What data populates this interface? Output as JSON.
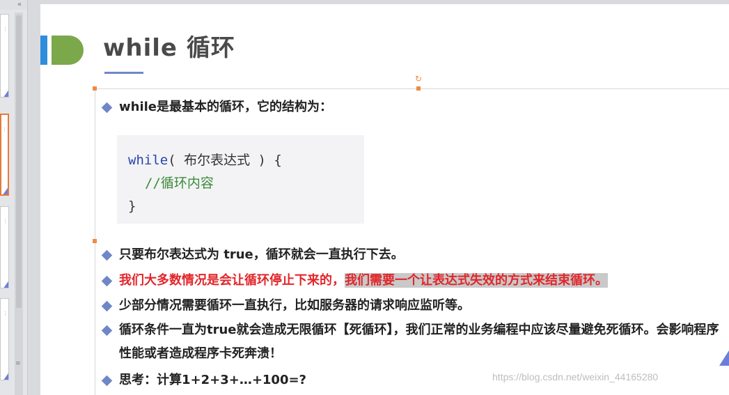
{
  "thumbnails": {
    "collapse_arrow": "«",
    "dots": "⋮",
    "grip": "≡"
  },
  "slide": {
    "title": "while 循环",
    "rotate_glyph": "↻",
    "bullets": {
      "b1": "while是最基本的循环，它的结构为：",
      "b2": "只要布尔表达式为 true，循环就会一直执行下去。",
      "b3_part1": "我们大多数情况是会让循环停止下来的，",
      "b3_part2": "我们需要一个让表达式失效的方式来结束循环。",
      "b4": "少部分情况需要循环一直执行，比如服务器的请求响应监听等。",
      "b5": "循环条件一直为true就会造成无限循环【死循环】，我们正常的业务编程中应该尽量避免死循环。会影响程序性能或者造成程序卡死奔溃！",
      "b6": "思考：计算1+2+3+…+100=?"
    },
    "code": {
      "keyword": "while",
      "line1_rest": "( 布尔表达式 ) {",
      "line2": "//循环内容",
      "line3": "}"
    },
    "colors": {
      "accent_blue": "#2f8ddd",
      "accent_green": "#7ba84a",
      "bullet": "#6f87c9",
      "emphasis_red": "#e2262a",
      "handle_orange": "#f08a45"
    }
  },
  "watermark": "https://blog.csdn.net/weixin_44165280"
}
